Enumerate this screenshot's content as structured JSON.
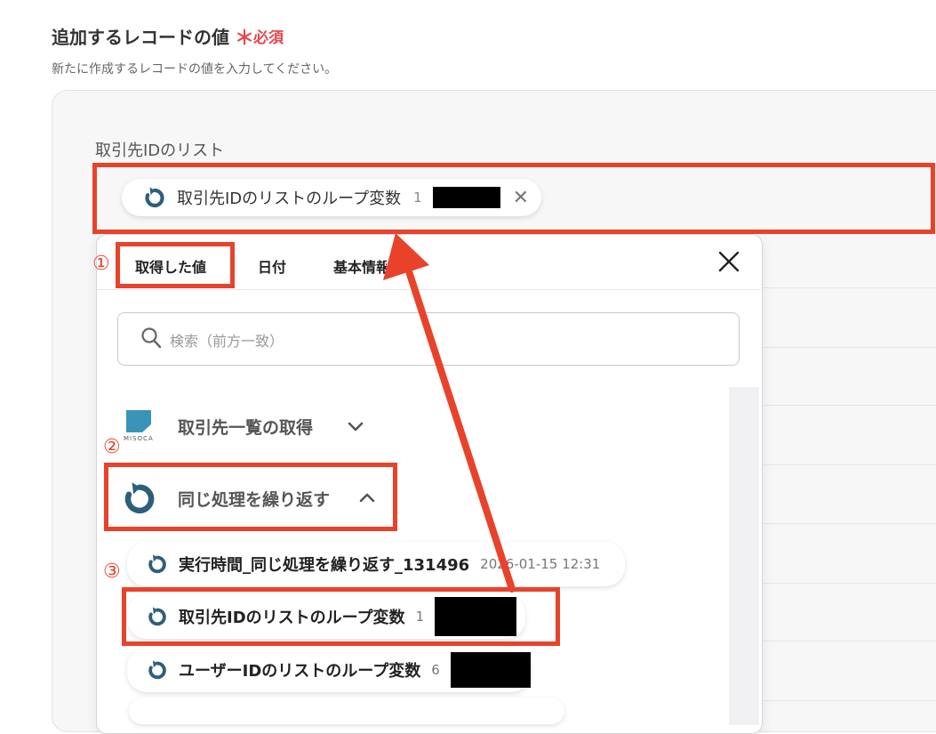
{
  "section": {
    "title": "追加するレコードの値",
    "required_mark": "＊",
    "required_label": "必須",
    "description": "新たに作成するレコードの値を入力してください。"
  },
  "field": {
    "label": "取引先IDのリスト",
    "selected_chip": {
      "label": "取引先IDのリストのループ変数",
      "value_prefix": "1"
    }
  },
  "dropdown": {
    "tabs": [
      {
        "label": "取得した値"
      },
      {
        "label": "日付"
      },
      {
        "label": "基本情報"
      }
    ],
    "search_placeholder": "検索（前方一致）",
    "groups": [
      {
        "label": "取引先一覧の取得",
        "logo_text": "MISOCA"
      },
      {
        "label": "同じ処理を繰り返す"
      }
    ],
    "items": [
      {
        "label": "実行時間_同じ処理を繰り返す_131496",
        "value": "2026-01-15 12:31"
      },
      {
        "label": "取引先IDのリストのループ変数",
        "value": "1"
      },
      {
        "label": "ユーザーIDのリストのループ変数",
        "value": "6"
      }
    ]
  },
  "annotations": {
    "step1": "①",
    "step2": "②",
    "step3": "③",
    "color": "#e8432a"
  },
  "colors": {
    "loop_icon": "#2d5f7a",
    "misoca": "#3a94b8",
    "required": "#e5484d"
  }
}
